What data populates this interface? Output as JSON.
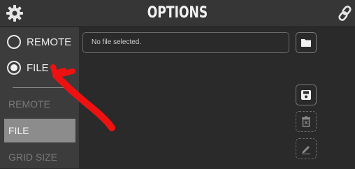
{
  "header": {
    "title": "OPTIONS"
  },
  "source": {
    "options": [
      {
        "label": "REMOTE",
        "selected": false
      },
      {
        "label": "FILE",
        "selected": true
      }
    ]
  },
  "sidebar": {
    "items": [
      {
        "label": "REMOTE"
      },
      {
        "label": "FILE"
      },
      {
        "label": "GRID SIZE"
      }
    ]
  },
  "file": {
    "status": "No file selected."
  },
  "colors": {
    "annotation_arrow": "#ee1111",
    "active_item_bg": "#8c8c8c"
  }
}
